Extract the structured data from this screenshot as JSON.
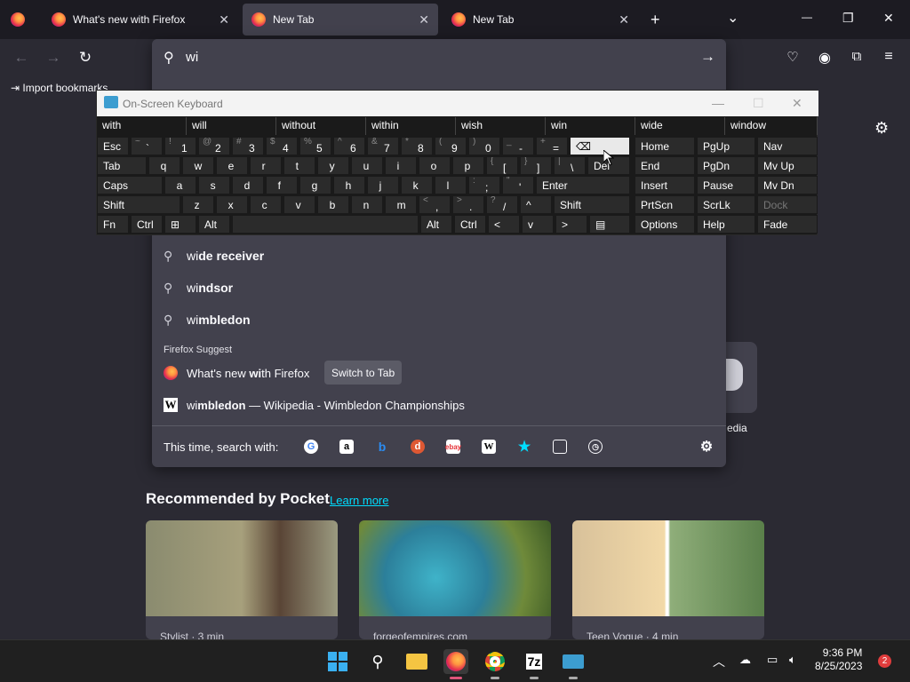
{
  "tabs": [
    {
      "title": "What's new with Firefox",
      "active": false
    },
    {
      "title": "New Tab",
      "active": true
    },
    {
      "title": "New Tab",
      "active": false
    }
  ],
  "window": {
    "new_tab": "+",
    "list_tabs": "⌄",
    "minimize": "—",
    "maximize": "❐",
    "close": "✕"
  },
  "urlbar": {
    "value": "wi",
    "go_icon": "arrow-right-icon"
  },
  "bookmarks": {
    "import_label": "Import bookmarks"
  },
  "suggestions": [
    {
      "typed": "wi",
      "rest": "de receiver"
    },
    {
      "typed": "wi",
      "rest": "ndsor"
    },
    {
      "typed": "wi",
      "rest": "mbledon"
    }
  ],
  "firefox_suggest": {
    "header": "Firefox Suggest",
    "tab_result": {
      "pre": "What's new ",
      "bold": "wi",
      "post": "th Firefox",
      "button": "Switch to Tab"
    },
    "wiki_result": {
      "typed": "wi",
      "bold": "mbledon",
      "rest": " — Wikipedia - Wimbledon Championships"
    }
  },
  "search_with": {
    "label": "This time, search with:"
  },
  "osk": {
    "title": "On-Screen Keyboard",
    "suggestions": [
      "with",
      "will",
      "without",
      "within",
      "wish",
      "win",
      "wide",
      "window"
    ]
  },
  "pocket": {
    "header": "Recommended by Pocket",
    "learn_more": "Learn more",
    "cards": [
      {
        "source": "Stylist · 3 min"
      },
      {
        "source": "forgeofempires.com"
      },
      {
        "source": "Teen Vogue · 4 min"
      }
    ]
  },
  "shortcut_label": "edia",
  "clock": {
    "time": "9:36 PM",
    "date": "8/25/2023"
  },
  "notifications": "2",
  "colors": {
    "accent": "#00ddff",
    "panel": "#42414d",
    "bg": "#2b2a33"
  }
}
